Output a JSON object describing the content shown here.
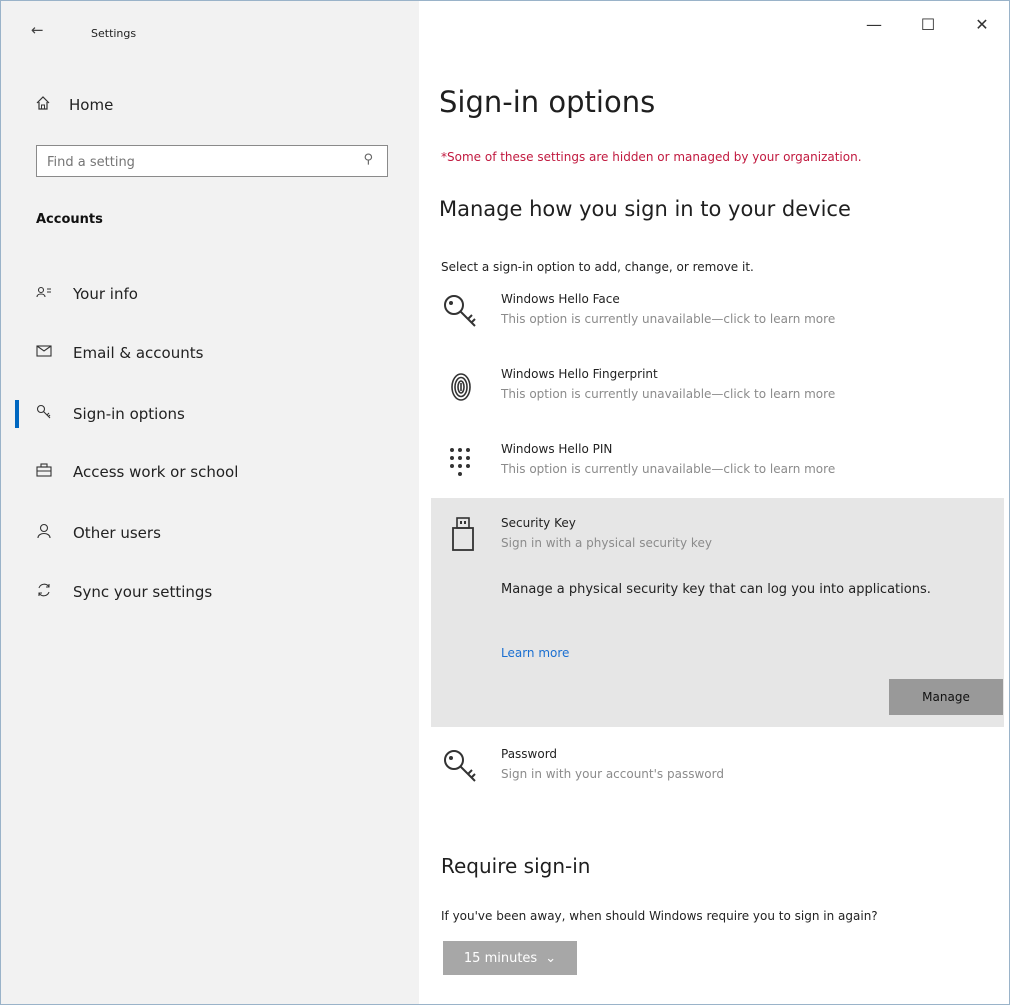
{
  "titlebar": {
    "app_title": "Settings",
    "back_glyph": "←",
    "minimize_glyph": "—",
    "maximize_glyph": "☐",
    "close_glyph": "✕"
  },
  "sidebar": {
    "home_label": "Home",
    "search": {
      "placeholder": "Find a setting",
      "icon": "search-icon"
    },
    "section_title": "Accounts",
    "items": [
      {
        "label": "Your info",
        "icon": "person-card-icon",
        "selected": false
      },
      {
        "label": "Email & accounts",
        "icon": "mail-icon",
        "selected": false
      },
      {
        "label": "Sign-in options",
        "icon": "key-icon",
        "selected": true
      },
      {
        "label": "Access work or school",
        "icon": "briefcase-icon",
        "selected": false
      },
      {
        "label": "Other users",
        "icon": "person-icon",
        "selected": false
      },
      {
        "label": "Sync your settings",
        "icon": "sync-icon",
        "selected": false
      }
    ]
  },
  "main": {
    "page_title": "Sign-in options",
    "managed_warning": "*Some of these settings are hidden or managed by your organization.",
    "manage_heading": "Manage how you sign in to your device",
    "select_hint": "Select a sign-in option to add, change, or remove it.",
    "options": [
      {
        "title": "Windows Hello Face",
        "subtitle": "This option is currently unavailable—click to learn more",
        "icon": "face-key-icon"
      },
      {
        "title": "Windows Hello Fingerprint",
        "subtitle": "This option is currently unavailable—click to learn more",
        "icon": "fingerprint-icon"
      },
      {
        "title": "Windows Hello PIN",
        "subtitle": "This option is currently unavailable—click to learn more",
        "icon": "pin-keypad-icon"
      },
      {
        "title": "Security Key",
        "subtitle": "Sign in with a physical security key",
        "icon": "usb-key-icon",
        "expanded": true
      },
      {
        "title": "Password",
        "subtitle": "Sign in with your account's password",
        "icon": "password-key-icon"
      }
    ],
    "security_key_detail": {
      "description": "Manage a physical security key that can log you into applications.",
      "learn_more": "Learn more",
      "button_label": "Manage"
    },
    "require_heading": "Require sign-in",
    "require_question": "If you've been away, when should Windows require you to sign in again?",
    "require_dropdown_value": "15 minutes",
    "accent_color": "#0067c0",
    "warning_color": "#c1193f",
    "link_color": "#1a6fd1"
  }
}
